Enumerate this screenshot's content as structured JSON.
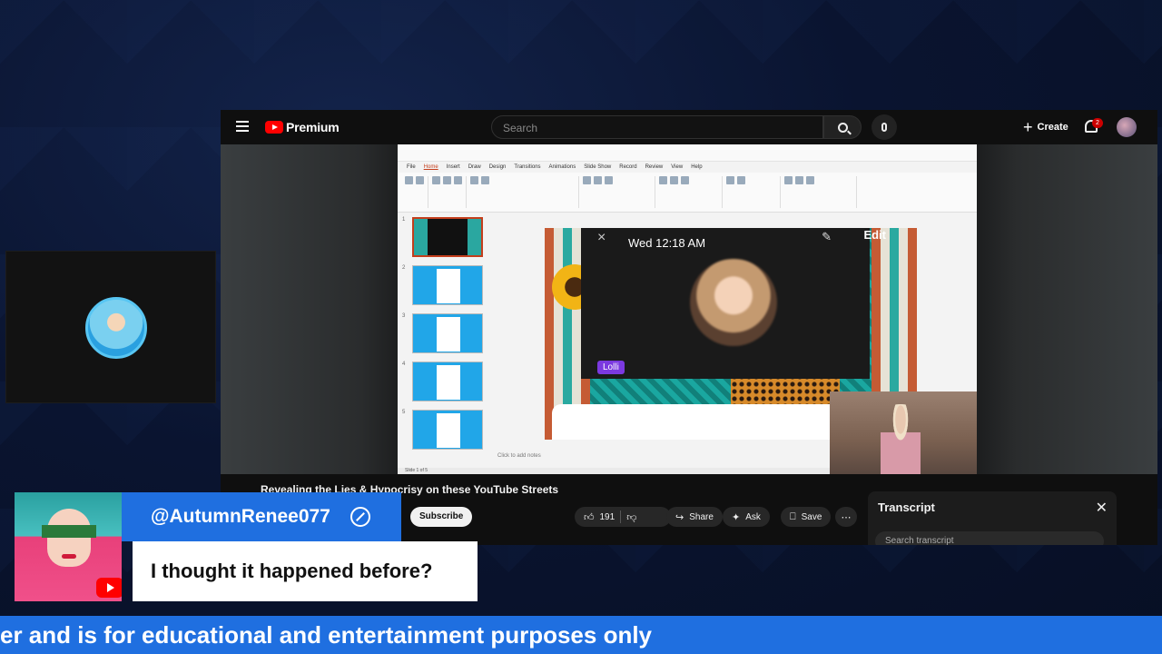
{
  "youtube": {
    "brand": "Premium",
    "search_placeholder": "Search",
    "create_label": "Create",
    "notification_count": "2",
    "video_title": "Revealing the Lies & Hypocrisy on these YouTube Streets",
    "subscribe_label": "Subscribe",
    "like_count": "191",
    "share_label": "Share",
    "ask_label": "Ask",
    "save_label": "Save",
    "transcript_title": "Transcript",
    "transcript_search_placeholder": "Search transcript"
  },
  "powerpoint": {
    "menu": [
      "File",
      "Home",
      "Insert",
      "Draw",
      "Design",
      "Transitions",
      "Animations",
      "Slide Show",
      "Record",
      "Review",
      "View",
      "Help"
    ],
    "active_menu": "Home",
    "slide_numbers": [
      "1",
      "2",
      "3",
      "4",
      "5"
    ],
    "notes_placeholder": "Click to add notes",
    "status": "Slide 1 of 5"
  },
  "call_overlay": {
    "time": "Wed 12:18 AM",
    "edit_label": "Edit",
    "participant": "Lolli"
  },
  "comment": {
    "username": "@AutumnRenee077",
    "text": "I thought it happened before?"
  },
  "ticker": {
    "text": "er and is for educational and entertainment purposes only"
  },
  "colors": {
    "brand_blue": "#1f6fe0",
    "youtube_red": "#ff0000",
    "call_chip": "#7b39e0"
  }
}
